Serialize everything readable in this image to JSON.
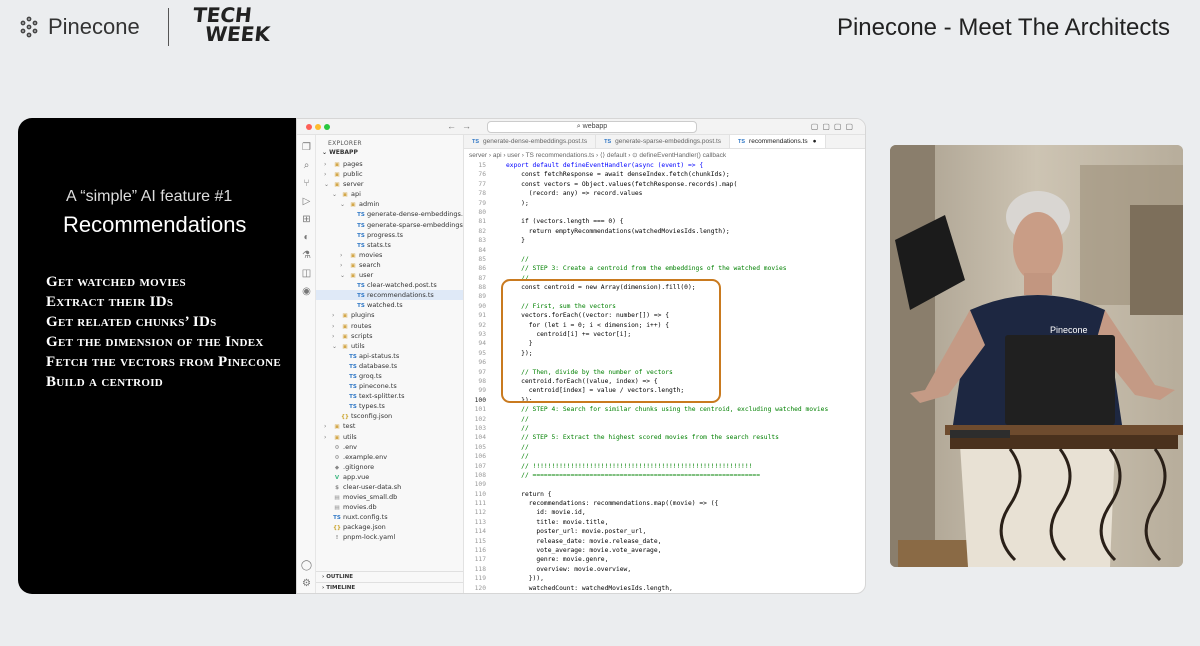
{
  "brand": {
    "name": "Pinecone",
    "event_logo_line1": "TECH",
    "event_logo_line2": "WEEK"
  },
  "event_title": "Pinecone - Meet The Architects",
  "slide": {
    "subtitle": "A “simple” AI feature #1",
    "title": "Recommendations",
    "bullets": [
      "Get watched movies",
      "Extract their IDs",
      "Get related chunks’ IDs",
      "Get the dimension of the Index",
      "Fetch the vectors from Pinecone",
      "Build a centroid"
    ]
  },
  "editor": {
    "search": "webapp",
    "explorer_title": "EXPLORER",
    "root": "WEBAPP",
    "tree": [
      {
        "label": "pages",
        "depth": 0,
        "chev": "›",
        "icon": "▣"
      },
      {
        "label": "public",
        "depth": 0,
        "chev": "›",
        "icon": "▣"
      },
      {
        "label": "server",
        "depth": 0,
        "chev": "⌄",
        "icon": "▣"
      },
      {
        "label": "api",
        "depth": 1,
        "chev": "⌄",
        "icon": "▣"
      },
      {
        "label": "admin",
        "depth": 2,
        "chev": "⌄",
        "icon": "▣"
      },
      {
        "label": "generate-dense-embeddings.po...",
        "depth": 3,
        "chev": "",
        "icon": "TS"
      },
      {
        "label": "generate-sparse-embeddings.p...",
        "depth": 3,
        "chev": "",
        "icon": "TS"
      },
      {
        "label": "progress.ts",
        "depth": 3,
        "chev": "",
        "icon": "TS"
      },
      {
        "label": "stats.ts",
        "depth": 3,
        "chev": "",
        "icon": "TS"
      },
      {
        "label": "movies",
        "depth": 2,
        "chev": "›",
        "icon": "▣"
      },
      {
        "label": "search",
        "depth": 2,
        "chev": "›",
        "icon": "▣"
      },
      {
        "label": "user",
        "depth": 2,
        "chev": "⌄",
        "icon": "▣"
      },
      {
        "label": "clear-watched.post.ts",
        "depth": 3,
        "chev": "",
        "icon": "TS"
      },
      {
        "label": "recommendations.ts",
        "depth": 3,
        "chev": "",
        "icon": "TS",
        "selected": true
      },
      {
        "label": "watched.ts",
        "depth": 3,
        "chev": "",
        "icon": "TS"
      },
      {
        "label": "plugins",
        "depth": 1,
        "chev": "›",
        "icon": "▣"
      },
      {
        "label": "routes",
        "depth": 1,
        "chev": "›",
        "icon": "▣"
      },
      {
        "label": "scripts",
        "depth": 1,
        "chev": "›",
        "icon": "▣"
      },
      {
        "label": "utils",
        "depth": 1,
        "chev": "⌄",
        "icon": "▣"
      },
      {
        "label": "api-status.ts",
        "depth": 2,
        "chev": "",
        "icon": "TS"
      },
      {
        "label": "database.ts",
        "depth": 2,
        "chev": "",
        "icon": "TS"
      },
      {
        "label": "groq.ts",
        "depth": 2,
        "chev": "",
        "icon": "TS"
      },
      {
        "label": "pinecone.ts",
        "depth": 2,
        "chev": "",
        "icon": "TS"
      },
      {
        "label": "text-splitter.ts",
        "depth": 2,
        "chev": "",
        "icon": "TS"
      },
      {
        "label": "types.ts",
        "depth": 2,
        "chev": "",
        "icon": "TS"
      },
      {
        "label": "tsconfig.json",
        "depth": 1,
        "chev": "",
        "icon": "{}"
      },
      {
        "label": "test",
        "depth": 0,
        "chev": "›",
        "icon": "▣"
      },
      {
        "label": "utils",
        "depth": 0,
        "chev": "›",
        "icon": "▣"
      },
      {
        "label": ".env",
        "depth": 0,
        "chev": "",
        "icon": "⚙"
      },
      {
        "label": ".example.env",
        "depth": 0,
        "chev": "",
        "icon": "⚙"
      },
      {
        "label": ".gitignore",
        "depth": 0,
        "chev": "",
        "icon": "◆"
      },
      {
        "label": "app.vue",
        "depth": 0,
        "chev": "",
        "icon": "V"
      },
      {
        "label": "clear-user-data.sh",
        "depth": 0,
        "chev": "",
        "icon": "$"
      },
      {
        "label": "movies_small.db",
        "depth": 0,
        "chev": "",
        "icon": "▤"
      },
      {
        "label": "movies.db",
        "depth": 0,
        "chev": "",
        "icon": "▤"
      },
      {
        "label": "nuxt.config.ts",
        "depth": 0,
        "chev": "",
        "icon": "TS"
      },
      {
        "label": "package.json",
        "depth": 0,
        "chev": "",
        "icon": "{}"
      },
      {
        "label": "pnpm-lock.yaml",
        "depth": 0,
        "chev": "",
        "icon": "!"
      }
    ],
    "outline_label": "OUTLINE",
    "timeline_label": "TIMELINE",
    "tabs": [
      {
        "label": "generate-dense-embeddings.post.ts",
        "active": false
      },
      {
        "label": "generate-sparse-embeddings.post.ts",
        "active": false
      },
      {
        "label": "recommendations.ts",
        "active": true
      }
    ],
    "breadcrumb": "server › api › user › TS recommendations.ts › ⟨⟩ default › ⊙ defineEventHandler() callback",
    "code_lines": [
      {
        "n": "15",
        "t": "export default defineEventHandler(async (event) => {",
        "k": "kw"
      },
      {
        "n": "76",
        "t": "    const fetchResponse = await denseIndex.fetch(chunkIds);",
        "k": ""
      },
      {
        "n": "77",
        "t": "    const vectors = Object.values(fetchResponse.records).map(",
        "k": ""
      },
      {
        "n": "78",
        "t": "      (record: any) => record.values",
        "k": ""
      },
      {
        "n": "79",
        "t": "    );",
        "k": ""
      },
      {
        "n": "80",
        "t": "",
        "k": ""
      },
      {
        "n": "81",
        "t": "    if (vectors.length === 0) {",
        "k": ""
      },
      {
        "n": "82",
        "t": "      return emptyRecommendations(watchedMoviesIds.length);",
        "k": ""
      },
      {
        "n": "83",
        "t": "    }",
        "k": ""
      },
      {
        "n": "84",
        "t": "",
        "k": ""
      },
      {
        "n": "85",
        "t": "    //",
        "k": "cm"
      },
      {
        "n": "86",
        "t": "    // STEP 3: Create a centroid from the embeddings of the watched movies",
        "k": "cm"
      },
      {
        "n": "87",
        "t": "    //",
        "k": "cm"
      },
      {
        "n": "88",
        "t": "    const centroid = new Array(dimension).fill(0);",
        "k": ""
      },
      {
        "n": "89",
        "t": "",
        "k": ""
      },
      {
        "n": "90",
        "t": "    // First, sum the vectors",
        "k": "cm"
      },
      {
        "n": "91",
        "t": "    vectors.forEach((vector: number[]) => {",
        "k": ""
      },
      {
        "n": "92",
        "t": "      for (let i = 0; i < dimension; i++) {",
        "k": ""
      },
      {
        "n": "93",
        "t": "        centroid[i] += vector[i];",
        "k": ""
      },
      {
        "n": "94",
        "t": "      }",
        "k": ""
      },
      {
        "n": "95",
        "t": "    });",
        "k": ""
      },
      {
        "n": "96",
        "t": "",
        "k": ""
      },
      {
        "n": "97",
        "t": "    // Then, divide by the number of vectors",
        "k": "cm"
      },
      {
        "n": "98",
        "t": "    centroid.forEach((value, index) => {",
        "k": ""
      },
      {
        "n": "99",
        "t": "      centroid[index] = value / vectors.length;",
        "k": ""
      },
      {
        "n": "100",
        "t": "    });",
        "k": "cur"
      },
      {
        "n": "101",
        "t": "    // STEP 4: Search for similar chunks using the centroid, excluding watched movies",
        "k": "cm"
      },
      {
        "n": "102",
        "t": "    //",
        "k": "cm"
      },
      {
        "n": "103",
        "t": "    //",
        "k": "cm"
      },
      {
        "n": "104",
        "t": "    // STEP 5: Extract the highest scored movies from the search results",
        "k": "cm"
      },
      {
        "n": "105",
        "t": "    //",
        "k": "cm"
      },
      {
        "n": "106",
        "t": "    //",
        "k": "cm"
      },
      {
        "n": "107",
        "t": "    // !!!!!!!!!!!!!!!!!!!!!!!!!!!!!!!!!!!!!!!!!!!!!!!!!!!!!!!!!!",
        "k": "cm"
      },
      {
        "n": "108",
        "t": "    // ============================================================",
        "k": "cm"
      },
      {
        "n": "109",
        "t": "",
        "k": ""
      },
      {
        "n": "110",
        "t": "    return {",
        "k": ""
      },
      {
        "n": "111",
        "t": "      recommendations: recommendations.map((movie) => ({",
        "k": ""
      },
      {
        "n": "112",
        "t": "        id: movie.id,",
        "k": ""
      },
      {
        "n": "113",
        "t": "        title: movie.title,",
        "k": ""
      },
      {
        "n": "114",
        "t": "        poster_url: movie.poster_url,",
        "k": ""
      },
      {
        "n": "115",
        "t": "        release_date: movie.release_date,",
        "k": ""
      },
      {
        "n": "116",
        "t": "        vote_average: movie.vote_average,",
        "k": ""
      },
      {
        "n": "117",
        "t": "        genre: movie.genre,",
        "k": ""
      },
      {
        "n": "118",
        "t": "        overview: movie.overview,",
        "k": ""
      },
      {
        "n": "119",
        "t": "      })),",
        "k": ""
      },
      {
        "n": "120",
        "t": "      watchedCount: watchedMoviesIds.length,",
        "k": ""
      },
      {
        "n": "121",
        "t": "    };",
        "k": ""
      },
      {
        "n": "122",
        "t": "",
        "k": ""
      }
    ]
  },
  "speaker_shirt_text": "Pinecone",
  "colors": {
    "accent_box": "#c97a1f",
    "slide_bg": "#000000",
    "page_bg": "#ebedef"
  }
}
